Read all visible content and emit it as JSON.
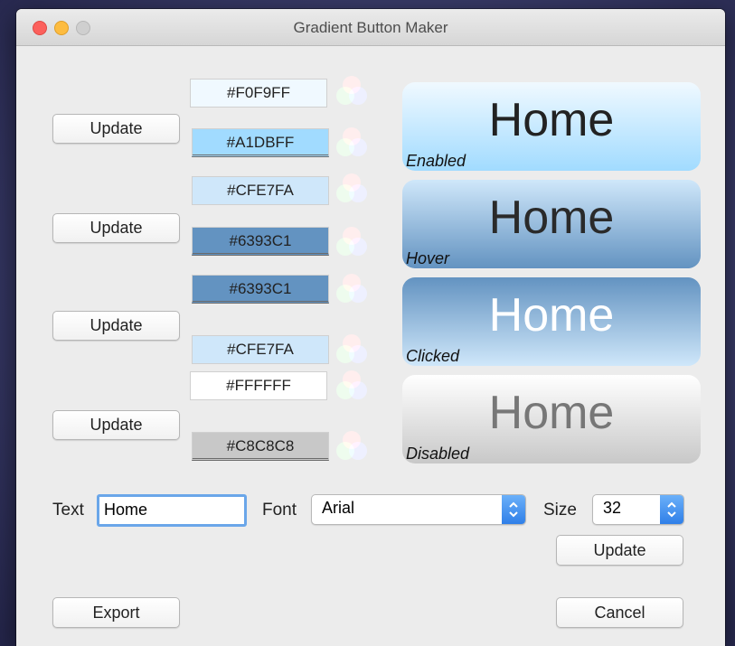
{
  "window": {
    "title": "Gradient Button Maker"
  },
  "rows": [
    {
      "update_label": "Update",
      "color_top": "#F0F9FF",
      "color_bottom": "#A1DBFF",
      "preview_text": "Home",
      "state_label": "Enabled"
    },
    {
      "update_label": "Update",
      "color_top": "#CFE7FA",
      "color_bottom": "#6393C1",
      "preview_text": "Home",
      "state_label": "Hover"
    },
    {
      "update_label": "Update",
      "color_top": "#6393C1",
      "color_bottom": "#CFE7FA",
      "preview_text": "Home",
      "state_label": "Clicked"
    },
    {
      "update_label": "Update",
      "color_top": "#FFFFFF",
      "color_bottom": "#C8C8C8",
      "preview_text": "Home",
      "state_label": "Disabled"
    }
  ],
  "controls": {
    "text_label": "Text",
    "text_value": "Home",
    "font_label": "Font",
    "font_value": "Arial",
    "size_label": "Size",
    "size_value": "32",
    "update_label": "Update",
    "export_label": "Export",
    "cancel_label": "Cancel"
  },
  "icons": {
    "color_picker": "rgb-color-wheel-icon",
    "dropdown": "chevron-updown-icon"
  }
}
